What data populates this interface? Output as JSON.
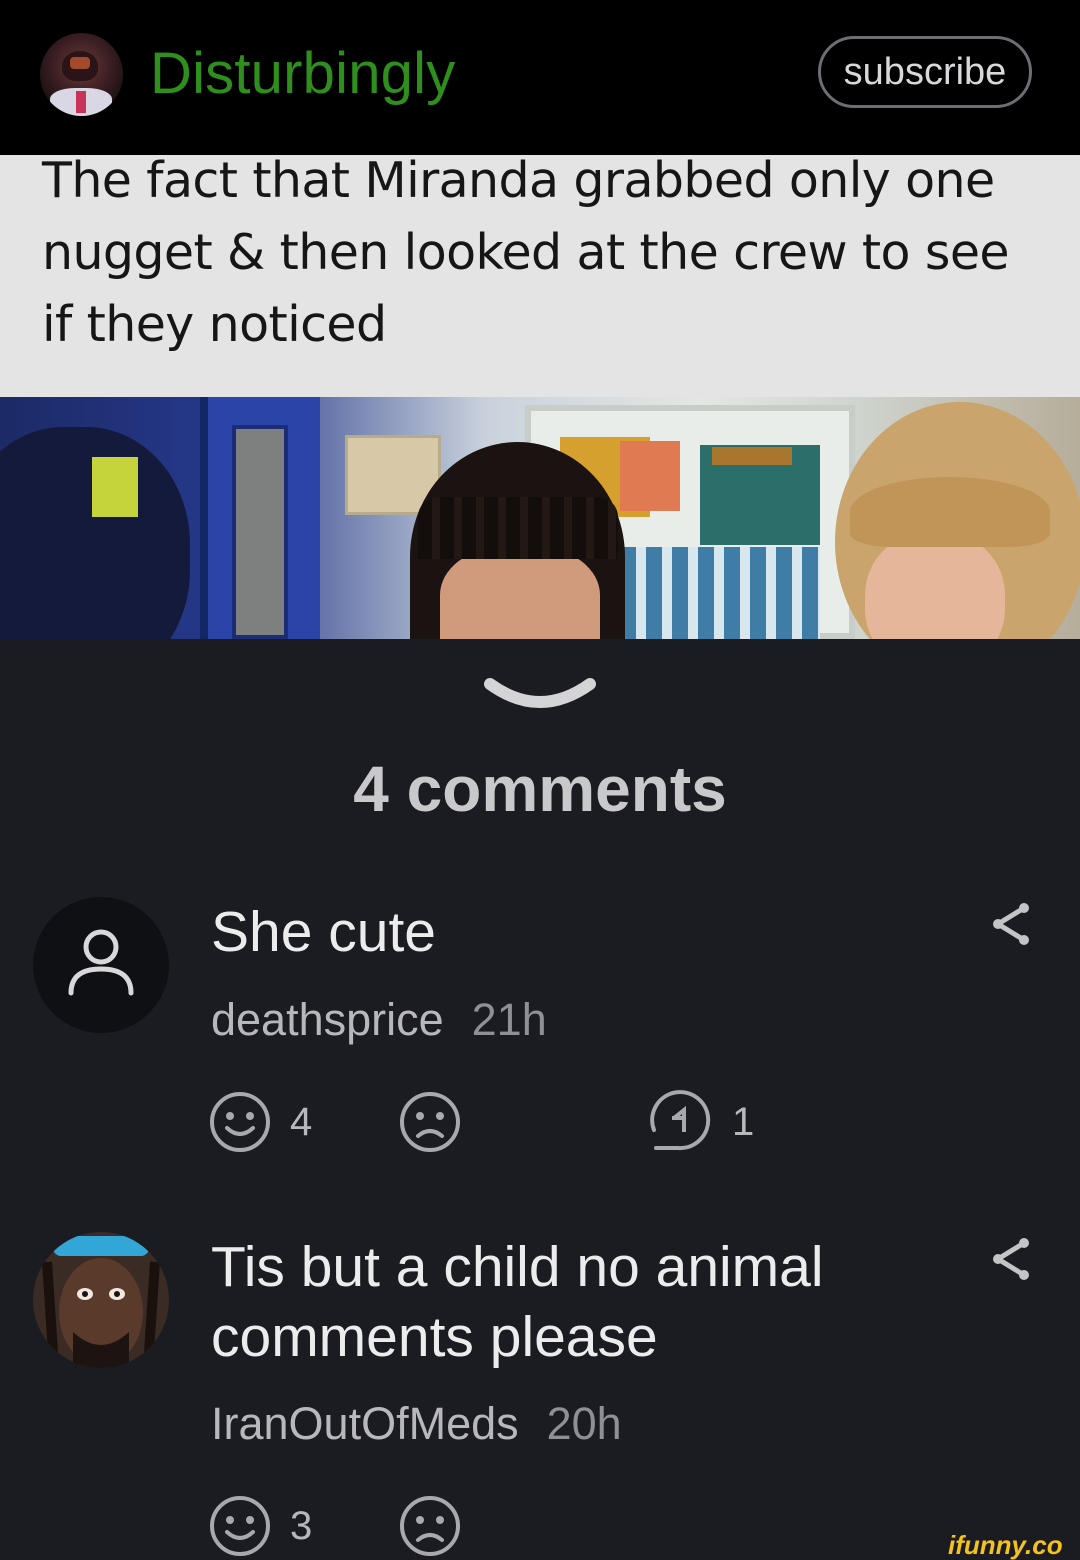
{
  "header": {
    "channel_name": "Disturbingly",
    "subscribe_label": "subscribe",
    "channel_name_color": "#2f8f1d"
  },
  "post": {
    "caption": "The fact that Miranda grabbed only one nugget & then looked at the crew to see if they noticed"
  },
  "comments_section": {
    "count_label": "4 comments",
    "collapse_icon": "chevron-down-icon"
  },
  "comments": [
    {
      "text": "She cute",
      "author": "deathsprice",
      "time": "21h",
      "likes": "4",
      "replies": "1",
      "avatar_icon": "user-icon"
    },
    {
      "text": "Tis but a child no animal comments please",
      "author": "IranOutOfMeds",
      "time": "20h",
      "likes": "3",
      "avatar_icon": "user-photo"
    }
  ],
  "icons": {
    "like": "smile-icon",
    "dislike": "frown-icon",
    "reply": "reply-icon",
    "share": "share-icon"
  },
  "watermark": "ifunny.co"
}
